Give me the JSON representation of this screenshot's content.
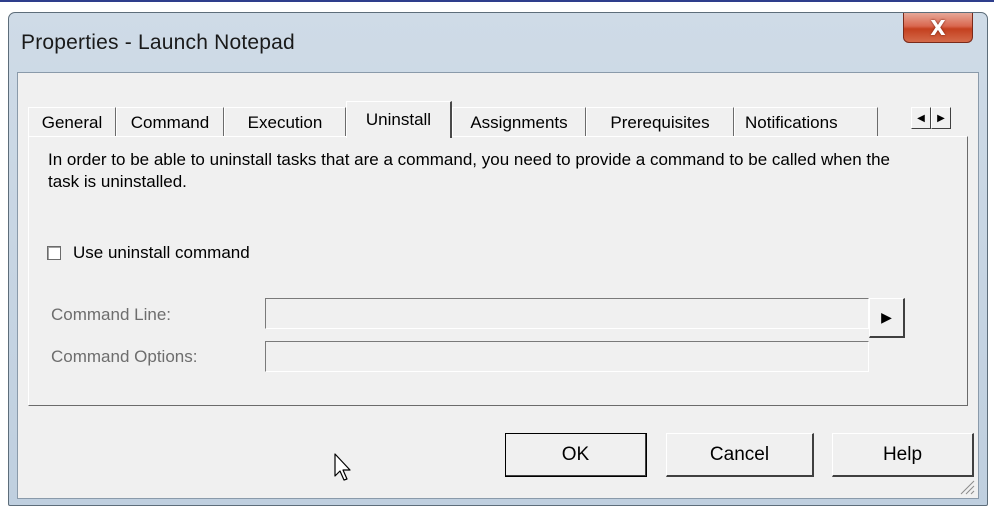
{
  "window": {
    "title": "Properties - Launch Notepad",
    "close_glyph": "X"
  },
  "tabs": [
    {
      "label": "General",
      "active": false
    },
    {
      "label": "Command",
      "active": false
    },
    {
      "label": "Execution",
      "active": false
    },
    {
      "label": "Uninstall",
      "active": true
    },
    {
      "label": "Assignments",
      "active": false
    },
    {
      "label": "Prerequisites",
      "active": false
    },
    {
      "label": "Notifications",
      "active": false
    }
  ],
  "tab_scroll": {
    "left_glyph": "◀",
    "right_glyph": "▶"
  },
  "uninstall": {
    "description": "In order to be able to uninstall tasks that are a command, you need to provide a command to be called when the task is uninstalled.",
    "use_uninstall_label": "Use uninstall command",
    "use_uninstall_checked": false,
    "command_line_label": "Command Line:",
    "command_line_value": "",
    "command_options_label": "Command Options:",
    "command_options_value": "",
    "browse_glyph": "▶"
  },
  "buttons": {
    "ok": "OK",
    "cancel": "Cancel",
    "help": "Help"
  },
  "colors": {
    "titlebar": "#cfdbe7",
    "client_bg": "#f0f0f0",
    "close_button": "#c4401f"
  },
  "icons": [
    "close-icon",
    "scroll-left-icon",
    "scroll-right-icon",
    "browse-arrow-icon",
    "mouse-cursor-icon",
    "resize-grip-icon"
  ]
}
